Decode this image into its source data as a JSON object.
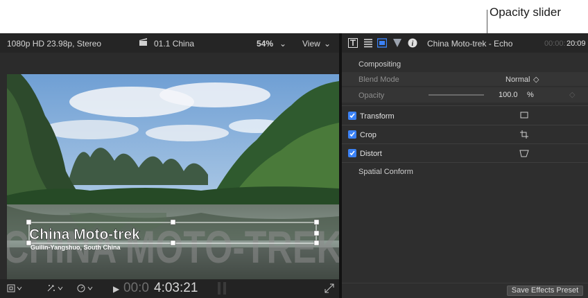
{
  "callout": {
    "label": "Opacity slider"
  },
  "viewer": {
    "format": "1080p HD 23.98p, Stereo",
    "clip_name": "01.1 China",
    "zoom": "54%",
    "view_label": "View",
    "title_main": "China Moto-trek",
    "title_sub": "Guilin-Yangshuo, South China",
    "watermark": "CHINA MOTO-TREK",
    "timecode_dim": "00:0",
    "timecode": "4:03:21"
  },
  "inspector": {
    "clip_title": "China Moto-trek - Echo",
    "duration_dim": "00:00:",
    "duration": "20:09",
    "compositing_label": "Compositing",
    "blend_mode_label": "Blend Mode",
    "blend_mode_value": "Normal",
    "opacity_label": "Opacity",
    "opacity_value": "100.0",
    "opacity_unit": "%",
    "opacity_level": 1.0,
    "sections": [
      {
        "label": "Transform",
        "checked": true
      },
      {
        "label": "Crop",
        "checked": true
      },
      {
        "label": "Distort",
        "checked": true
      }
    ],
    "spatial_conform_label": "Spatial Conform",
    "save_preset_label": "Save Effects Preset"
  },
  "colors": {
    "accent": "#3b82f6",
    "checkbox": "#3b82f6"
  }
}
